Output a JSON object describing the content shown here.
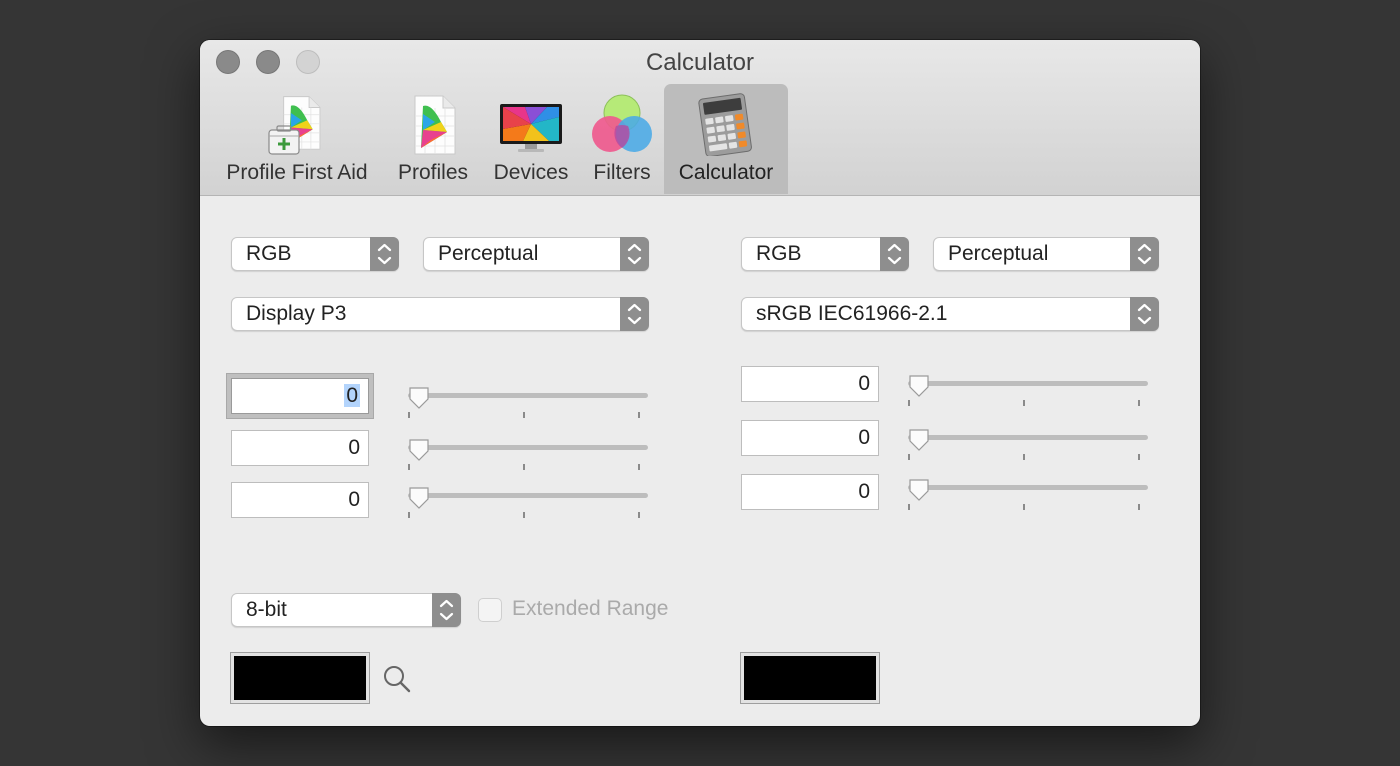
{
  "window": {
    "title": "Calculator"
  },
  "toolbar": {
    "tabs": [
      {
        "label": "Profile First Aid",
        "icon": "profile-first-aid-icon"
      },
      {
        "label": "Profiles",
        "icon": "profiles-icon"
      },
      {
        "label": "Devices",
        "icon": "devices-icon"
      },
      {
        "label": "Filters",
        "icon": "filters-icon"
      },
      {
        "label": "Calculator",
        "icon": "calculator-icon",
        "selected": true
      }
    ]
  },
  "left": {
    "color_space": "RGB",
    "intent": "Perceptual",
    "profile": "Display P3",
    "channels": [
      {
        "value": "0",
        "slider": 0
      },
      {
        "value": "0",
        "slider": 0
      },
      {
        "value": "0",
        "slider": 0
      }
    ],
    "bit_depth": "8-bit",
    "extended_range_label": "Extended Range",
    "extended_range_checked": false,
    "swatch_color": "#000000"
  },
  "right": {
    "color_space": "RGB",
    "intent": "Perceptual",
    "profile": "sRGB IEC61966-2.1",
    "channels": [
      {
        "value": "0",
        "slider": 0
      },
      {
        "value": "0",
        "slider": 0
      },
      {
        "value": "0",
        "slider": 0
      }
    ],
    "swatch_color": "#000000"
  },
  "colors": {
    "desktop": "#353535",
    "window_bg": "#ececec",
    "selected_tab": "#bcbcbc",
    "stepper": "#8e8e8e",
    "selection": "#b3d4fc"
  }
}
